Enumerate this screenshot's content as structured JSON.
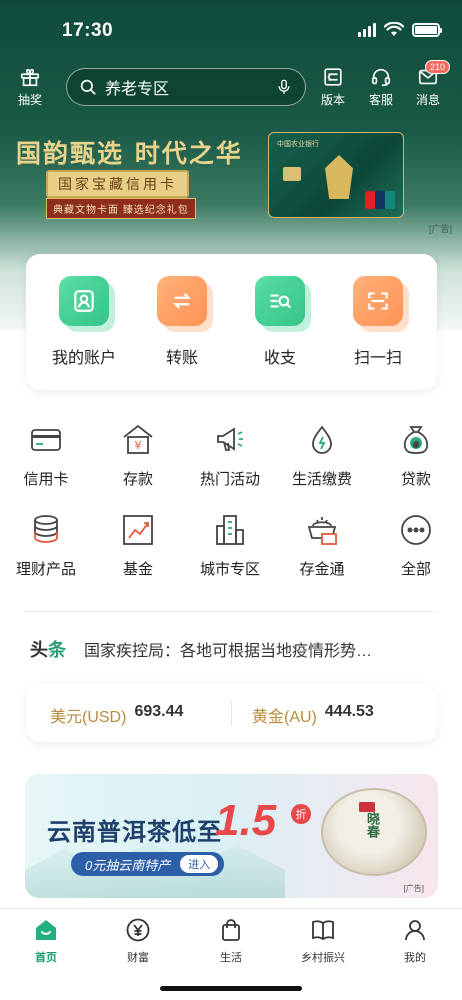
{
  "status_bar": {
    "time": "17:30"
  },
  "header": {
    "lottery_label": "抽奖",
    "search_placeholder": "养老专区",
    "version_label": "版本",
    "service_label": "客服",
    "messages_label": "消息",
    "messages_badge": "210"
  },
  "banner": {
    "title": "国韵甄选 时代之华",
    "subtitle": "国家宝藏信用卡",
    "note": "典藏文物卡面 臻选纪念礼包",
    "card_bank": "中国农业银行",
    "ad_tag": "[广告]"
  },
  "quick_actions": [
    {
      "label": "我的账户",
      "icon": "user-icon",
      "color": "#24bd83"
    },
    {
      "label": "转账",
      "icon": "transfer-icon",
      "color": "#ff8b4a"
    },
    {
      "label": "收支",
      "icon": "statement-icon",
      "color": "#24bd83"
    },
    {
      "label": "扫一扫",
      "icon": "scan-icon",
      "color": "#ff8b4a"
    }
  ],
  "services": [
    {
      "label": "信用卡",
      "icon": "credit-card-icon"
    },
    {
      "label": "存款",
      "icon": "deposit-icon"
    },
    {
      "label": "热门活动",
      "icon": "megaphone-icon"
    },
    {
      "label": "生活缴费",
      "icon": "water-drop-icon"
    },
    {
      "label": "贷款",
      "icon": "loan-bag-icon"
    },
    {
      "label": "理财产品",
      "icon": "coin-stack-icon"
    },
    {
      "label": "基金",
      "icon": "chart-trend-icon"
    },
    {
      "label": "城市专区",
      "icon": "building-icon"
    },
    {
      "label": "存金通",
      "icon": "gold-icon"
    },
    {
      "label": "全部",
      "icon": "more-icon"
    }
  ],
  "news": {
    "tag_prefix": "头",
    "tag_suffix": "条",
    "text": "国家疾控局：各地可根据当地疫情形势…"
  },
  "rates": [
    {
      "name": "美元(USD)",
      "value": "693.44"
    },
    {
      "name": "黄金(AU)",
      "value": "444.53"
    }
  ],
  "promo": {
    "title": "云南普洱茶低至",
    "number": "1.5",
    "unit": "折",
    "pill": "0元抽云南特产",
    "go": "进入",
    "tea_text": "晓春",
    "ad_tag": "[广告]"
  },
  "tabs": [
    {
      "label": "首页",
      "icon": "home-icon",
      "active": true
    },
    {
      "label": "财富",
      "icon": "yuan-icon",
      "active": false
    },
    {
      "label": "生活",
      "icon": "shopping-bag-icon",
      "active": false
    },
    {
      "label": "乡村振兴",
      "icon": "book-icon",
      "active": false
    },
    {
      "label": "我的",
      "icon": "person-icon",
      "active": false
    }
  ],
  "colors": {
    "brand": "#1f9d70",
    "header_dark": "#0f4a3c",
    "accent_orange": "#ff8b4a",
    "gold_text": "#b98b3b"
  }
}
